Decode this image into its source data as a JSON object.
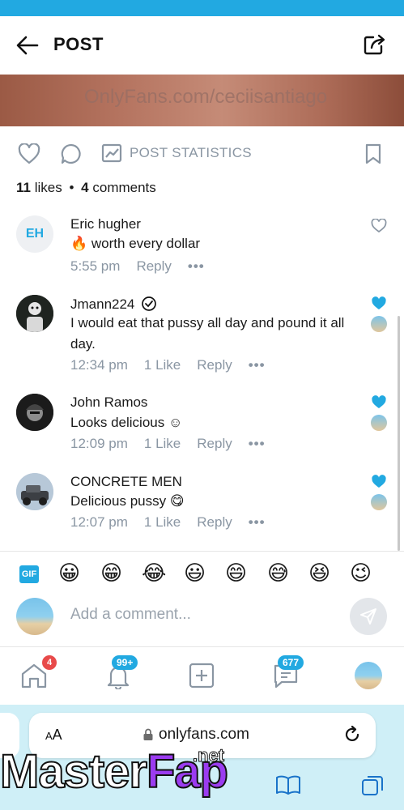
{
  "header": {
    "title": "POST"
  },
  "banner": {
    "watermark": "OnlyFans.com/ceciisantiago"
  },
  "actions": {
    "stats_label": "POST STATISTICS"
  },
  "meta": {
    "likes_count": "11",
    "likes_word": "likes",
    "separator": "•",
    "comments_count": "4",
    "comments_word": "comments"
  },
  "comments": [
    {
      "initials": "EH",
      "name": "Eric hugher",
      "text_emoji": "🔥",
      "text": "worth every dollar",
      "time": "5:55 pm",
      "like_label": "",
      "reply": "Reply",
      "more": "•••",
      "liked": false
    },
    {
      "name": "Jmann224",
      "verified": true,
      "text": "I would eat that pussy all day and pound it all day.",
      "time": "12:34 pm",
      "like_label": "1 Like",
      "reply": "Reply",
      "more": "•••",
      "liked": true
    },
    {
      "name": "John Ramos",
      "text": "Looks delicious",
      "text_emoji": "☺",
      "time": "12:09 pm",
      "like_label": "1 Like",
      "reply": "Reply",
      "more": "•••",
      "liked": true
    },
    {
      "name": "CONCRETE MEN",
      "text": "Delicious pussy",
      "text_emoji": "😋",
      "time": "12:07 pm",
      "like_label": "1 Like",
      "reply": "Reply",
      "more": "•••",
      "liked": true
    }
  ],
  "emoji_bar": {
    "gif_label": "GIF",
    "emojis": [
      "😀",
      "😁",
      "😂",
      "😃",
      "😄",
      "😅",
      "😆",
      "😉"
    ]
  },
  "composer": {
    "placeholder": "Add a comment..."
  },
  "tabbar": {
    "home_badge": "4",
    "notifications_badge": "99+",
    "messages_badge": "677"
  },
  "browser": {
    "aa_small": "A",
    "aa_large": "A",
    "url": "onlyfans.com"
  },
  "overlay": {
    "logo_part1": "Master",
    "logo_part2": "Fap",
    "logo_suffix": ".net"
  },
  "colors": {
    "accent": "#22a9e1",
    "muted": "#8a96a3",
    "badge_red": "#e84a4a"
  }
}
